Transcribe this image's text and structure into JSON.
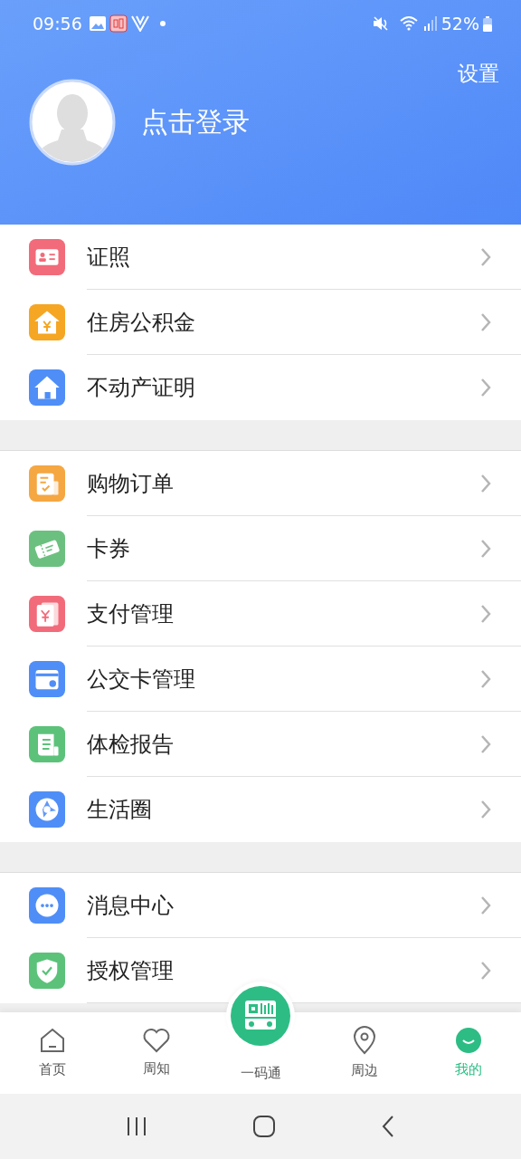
{
  "status_bar": {
    "time": "09:56",
    "battery": "52%"
  },
  "header": {
    "settings": "设置",
    "login": "点击登录"
  },
  "sections": [
    {
      "items": [
        {
          "label": "证照",
          "color": "#f26b7a"
        },
        {
          "label": "住房公积金",
          "color": "#f5a623"
        },
        {
          "label": "不动产证明",
          "color": "#4f8ef7"
        }
      ]
    },
    {
      "items": [
        {
          "label": "购物订单",
          "color": "#f5a742"
        },
        {
          "label": "卡券",
          "color": "#6cc07f"
        },
        {
          "label": "支付管理",
          "color": "#f26b7a"
        },
        {
          "label": "公交卡管理",
          "color": "#4f8ef7"
        },
        {
          "label": "体检报告",
          "color": "#5cc27a"
        },
        {
          "label": "生活圈",
          "color": "#4f8ef7"
        }
      ]
    },
    {
      "items": [
        {
          "label": "消息中心",
          "color": "#4f8ef7"
        },
        {
          "label": "授权管理",
          "color": "#5cc27a"
        }
      ]
    }
  ],
  "tab_bar": [
    {
      "label": "首页",
      "kind": "tab",
      "selected": false
    },
    {
      "label": "周知",
      "kind": "tab",
      "selected": false
    },
    {
      "label": "一码通",
      "kind": "center",
      "selected": false
    },
    {
      "label": "周边",
      "kind": "tab",
      "selected": false
    },
    {
      "label": "我的",
      "kind": "tab",
      "selected": true
    }
  ]
}
